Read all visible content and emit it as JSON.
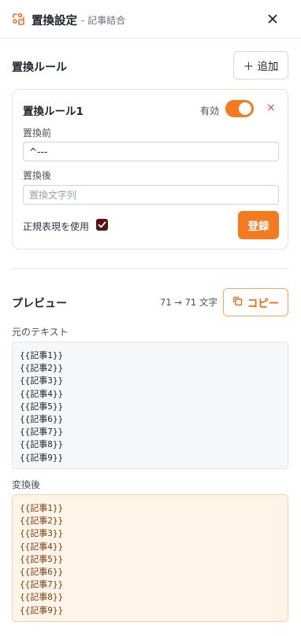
{
  "header": {
    "title": "置換設定",
    "subtitle": "- 記事結合",
    "logo_icon": "replace-icon",
    "close_icon": "close-icon"
  },
  "rules_section": {
    "title": "置換ルール",
    "add_button": "＋ 追加"
  },
  "rule": {
    "name": "置換ルール1",
    "enabled_label": "有効",
    "enabled": true,
    "delete_symbol": "×",
    "before_label": "置換前",
    "before_value": "^---",
    "after_label": "置換後",
    "after_value": "",
    "after_placeholder": "置換文字列",
    "regex_label": "正規表現を使用",
    "regex_checked": true,
    "register_button": "登録"
  },
  "preview": {
    "title": "プレビュー",
    "count_text": "71 → 71 文字",
    "copy_button": "コピー",
    "original_label": "元のテキスト",
    "original_text": "{{記事1}}\n{{記事2}}\n{{記事3}}\n{{記事4}}\n{{記事5}}\n{{記事6}}\n{{記事7}}\n{{記事8}}\n{{記事9}}",
    "converted_label": "変換後",
    "converted_text": "{{記事1}}\n{{記事2}}\n{{記事3}}\n{{記事4}}\n{{記事5}}\n{{記事6}}\n{{記事7}}\n{{記事8}}\n{{記事9}}"
  },
  "colors": {
    "accent": "#f47a1f",
    "checkbox": "#5c1111",
    "delete": "#e5484d"
  }
}
